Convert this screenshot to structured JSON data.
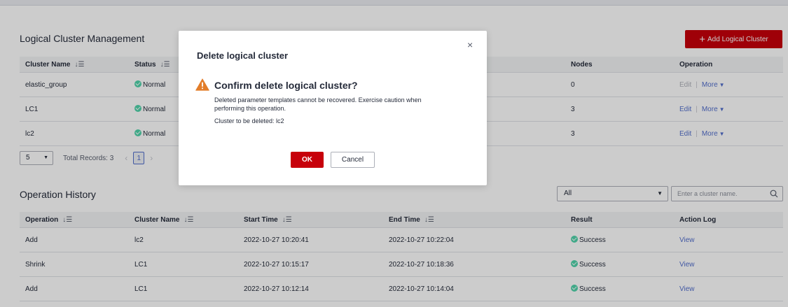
{
  "cluster_section": {
    "title": "Logical Cluster Management",
    "add_button_label": "Add Logical Cluster",
    "columns": [
      "Cluster Name",
      "Status",
      "Nodes",
      "Operation"
    ],
    "rows": [
      {
        "name": "elastic_group",
        "status": "Normal",
        "nodes": "0",
        "edit": "Edit",
        "more": "More"
      },
      {
        "name": "LC1",
        "status": "Normal",
        "nodes": "3",
        "edit": "Edit",
        "more": "More"
      },
      {
        "name": "lc2",
        "status": "Normal",
        "nodes": "3",
        "edit": "Edit",
        "more": "More"
      }
    ],
    "pagination": {
      "page_size": "5",
      "total": "Total Records: 3",
      "current_page": "1"
    }
  },
  "history_section": {
    "title": "Operation History",
    "filter_value": "All",
    "search_placeholder": "Enter a cluster name.",
    "columns": [
      "Operation",
      "Cluster Name",
      "Start Time",
      "End Time",
      "Result",
      "Action Log"
    ],
    "rows": [
      {
        "operation": "Add",
        "cluster": "lc2",
        "start": "2022-10-27 10:20:41",
        "end": "2022-10-27 10:22:04",
        "result": "Success",
        "log": "View"
      },
      {
        "operation": "Shrink",
        "cluster": "LC1",
        "start": "2022-10-27 10:15:17",
        "end": "2022-10-27 10:18:36",
        "result": "Success",
        "log": "View"
      },
      {
        "operation": "Add",
        "cluster": "LC1",
        "start": "2022-10-27 10:12:14",
        "end": "2022-10-27 10:14:04",
        "result": "Success",
        "log": "View"
      }
    ]
  },
  "dialog": {
    "title": "Delete logical cluster",
    "close_glyph": "×",
    "heading": "Confirm delete logical cluster?",
    "description": "Deleted parameter templates cannot be recovered. Exercise caution when performing this operation.",
    "target": "Cluster to be deleted: lc2",
    "ok_label": "OK",
    "cancel_label": "Cancel"
  },
  "colors": {
    "brand": "#c7000b",
    "link": "#526ecc",
    "success": "#50d4ab",
    "warning": "#e37d29"
  }
}
